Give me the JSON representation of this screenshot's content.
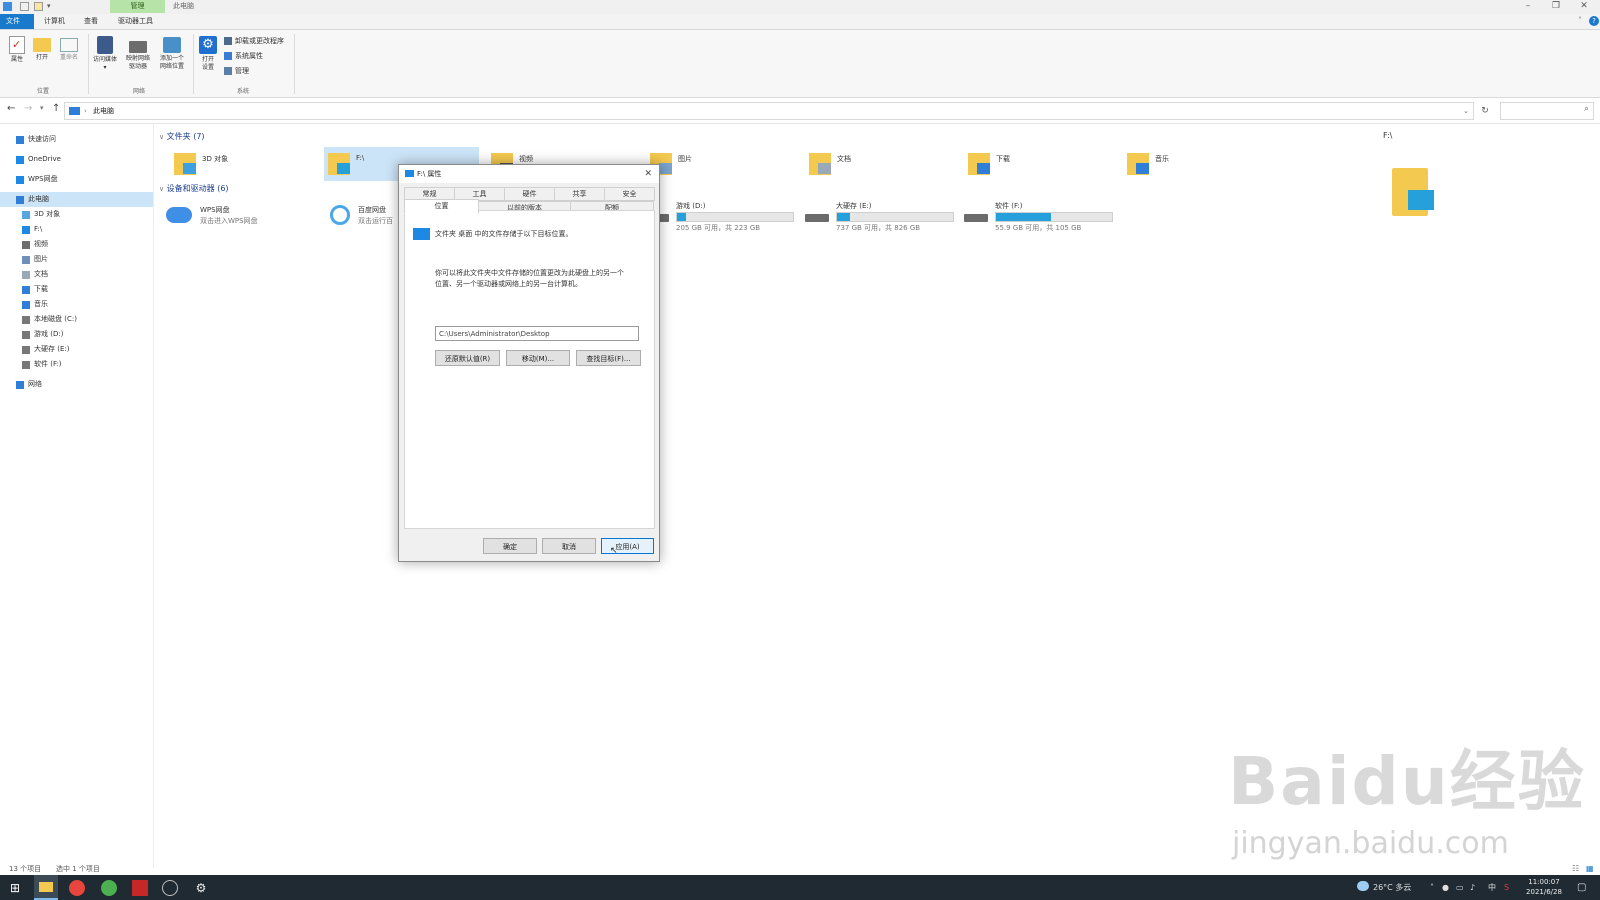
{
  "window": {
    "context_tab": "管理",
    "title": "此电脑"
  },
  "ribbon_tabs": [
    "文件",
    "计算机",
    "查看",
    "驱动器工具"
  ],
  "ribbon": {
    "location": {
      "buttons": [
        "属性",
        "打开",
        "重命名"
      ],
      "label": "位置"
    },
    "network": {
      "media_line1": "访问媒体",
      "map_drive_line1": "映射网络",
      "map_drive_line2": "驱动器",
      "add_location_line1": "添加一个",
      "add_location_line2": "网络位置",
      "label": "网络"
    },
    "system": {
      "open_settings_line1": "打开",
      "open_settings_line2": "设置",
      "uninstall": "卸载或更改程序",
      "properties": "系统属性",
      "manage": "管理",
      "label": "系统"
    }
  },
  "address": {
    "path": "此电脑"
  },
  "nav": [
    {
      "label": "快速访问",
      "icon": "star-icon"
    },
    {
      "label": "OneDrive",
      "icon": "cloud-icon"
    },
    {
      "label": "WPS网盘",
      "icon": "cloud-icon"
    },
    {
      "label": "此电脑",
      "icon": "computer-icon"
    },
    {
      "label": "3D 对象",
      "icon": "cube-icon"
    },
    {
      "label": "F:\\",
      "icon": "desktop-icon"
    },
    {
      "label": "视频",
      "icon": "video-icon"
    },
    {
      "label": "图片",
      "icon": "picture-icon"
    },
    {
      "label": "文档",
      "icon": "document-icon"
    },
    {
      "label": "下载",
      "icon": "download-icon"
    },
    {
      "label": "音乐",
      "icon": "music-icon"
    },
    {
      "label": "本地磁盘 (C:)",
      "icon": "drive-icon"
    },
    {
      "label": "游戏 (D:)",
      "icon": "drive-icon"
    },
    {
      "label": "大硬存 (E:)",
      "icon": "drive-icon"
    },
    {
      "label": "软件 (F:)",
      "icon": "drive-icon"
    },
    {
      "label": "网络",
      "icon": "network-icon"
    }
  ],
  "folders_section": {
    "title": "文件夹 (7)",
    "items": [
      "3D 对象",
      "F:\\",
      "视频",
      "图片",
      "文档",
      "下载",
      "音乐"
    ]
  },
  "devices_section": {
    "title": "设备和驱动器 (6)",
    "wps": {
      "name": "WPS网盘",
      "sub": "双击进入WPS网盘"
    },
    "baidu": {
      "name": "百度网盘",
      "sub": "双击运行百"
    },
    "drives": [
      {
        "name": "游戏 (D:)",
        "sub": "205 GB 可用，共 223 GB",
        "used_fraction": 0.08
      },
      {
        "name": "大硬存 (E:)",
        "sub": "737 GB 可用，共 826 GB",
        "used_fraction": 0.11
      },
      {
        "name": "软件 (F:)",
        "sub": "55.9 GB 可用，共 105 GB",
        "used_fraction": 0.47
      }
    ]
  },
  "preview": {
    "title": "F:\\"
  },
  "dialog": {
    "title": "F:\\ 属性",
    "tabs_row1": [
      "常规",
      "工具",
      "硬件",
      "共享",
      "安全"
    ],
    "tabs_row2": [
      "位置",
      "以前的版本",
      "配额"
    ],
    "desc1": "文件夹 桌面 中的文件存储于以下目标位置。",
    "desc2_line1": "你可以将此文件夹中文件存储的位置更改为此硬盘上的另一个",
    "desc2_line2": "位置、另一个驱动器或网络上的另一台计算机。",
    "path_value": "C:\\Users\\Administrator\\Desktop",
    "btn_restore": "还原默认值(R)",
    "btn_move": "移动(M)...",
    "btn_find": "查找目标(F)...",
    "btn_ok": "确定",
    "btn_cancel": "取消",
    "btn_apply": "应用(A)"
  },
  "status": {
    "count": "13 个项目",
    "selected": "选中 1 个项目"
  },
  "taskbar": {
    "weather": "26°C 多云",
    "ime": "中",
    "time": "11:00:07",
    "date": "2021/6/28"
  },
  "watermark": {
    "line1": "Baidu经验",
    "line2": "jingyan.baidu.com"
  },
  "colors": {
    "accent": "#1979ca",
    "selection": "#cce4f7",
    "drive_fill": "#26a0da",
    "folder": "#f3c94f"
  }
}
